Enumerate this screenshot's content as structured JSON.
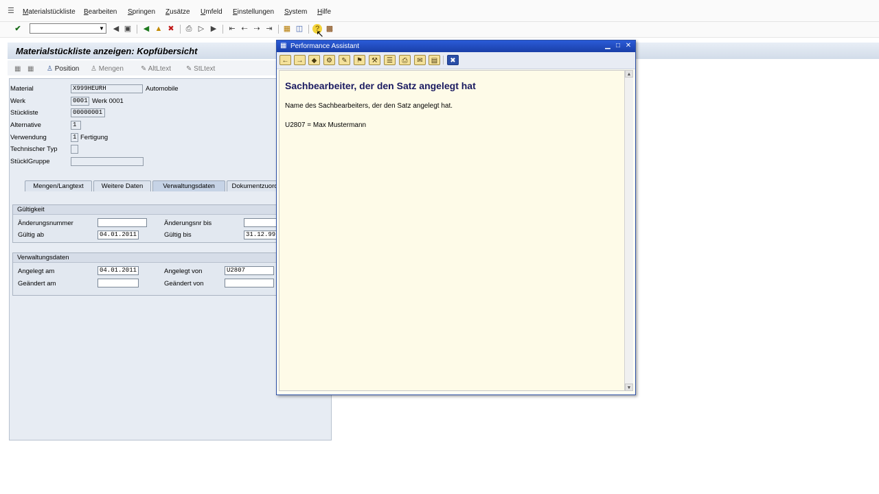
{
  "menu": {
    "items": [
      "Materialstückliste",
      "Bearbeiten",
      "Springen",
      "Zusätze",
      "Umfeld",
      "Einstellungen",
      "System",
      "Hilfe"
    ]
  },
  "toolbar": {
    "command_field_value": ""
  },
  "screen": {
    "title": "Materialstückliste anzeigen: Kopfübersicht",
    "app_toolbar": {
      "position": "Position",
      "mengen": "Mengen",
      "alt_text": "AltLtext",
      "stl_text": "StLtext"
    },
    "header": {
      "material_label": "Material",
      "material_value": "X999HEURH",
      "material_desc": "Automobile",
      "werk_label": "Werk",
      "werk_value": "0001",
      "werk_desc": "Werk 0001",
      "stueckliste_label": "Stückliste",
      "stueckliste_value": "00000001",
      "alternative_label": "Alternative",
      "alternative_value": "1",
      "verwendung_label": "Verwendung",
      "verwendung_value": "1",
      "verwendung_desc": "Fertigung",
      "techtyp_label": "Technischer Typ",
      "techtyp_value": "",
      "stueckgruppe_label": "StücklGruppe",
      "stueckgruppe_value": ""
    },
    "tabs": [
      "Mengen/Langtext",
      "Weitere Daten",
      "Verwaltungsdaten",
      "Dokumentzuord"
    ],
    "gueltigkeit": {
      "title": "Gültigkeit",
      "aenderungsnummer_label": "Änderungsnummer",
      "aenderungsnummer_value": "",
      "aenderungsnr_bis_label": "Änderungsnr bis",
      "aenderungsnr_bis_value": "",
      "gueltig_ab_label": "Gültig ab",
      "gueltig_ab_value": "04.01.2011",
      "gueltig_bis_label": "Gültig bis",
      "gueltig_bis_value": "31.12.99"
    },
    "verwaltungsdaten": {
      "title": "Verwaltungsdaten",
      "angelegt_am_label": "Angelegt am",
      "angelegt_am_value": "04.01.2011",
      "angelegt_von_label": "Angelegt von",
      "angelegt_von_value": "U2807",
      "geaendert_am_label": "Geändert am",
      "geaendert_am_value": "",
      "geaendert_von_label": "Geändert von",
      "geaendert_von_value": ""
    }
  },
  "popup": {
    "title": "Performance Assistant",
    "heading": "Sachbearbeiter, der den Satz angelegt hat",
    "paragraph1": "Name des Sachbearbeiters, der den Satz angelegt hat.",
    "paragraph2": "U2807 = Max Mustermann"
  }
}
